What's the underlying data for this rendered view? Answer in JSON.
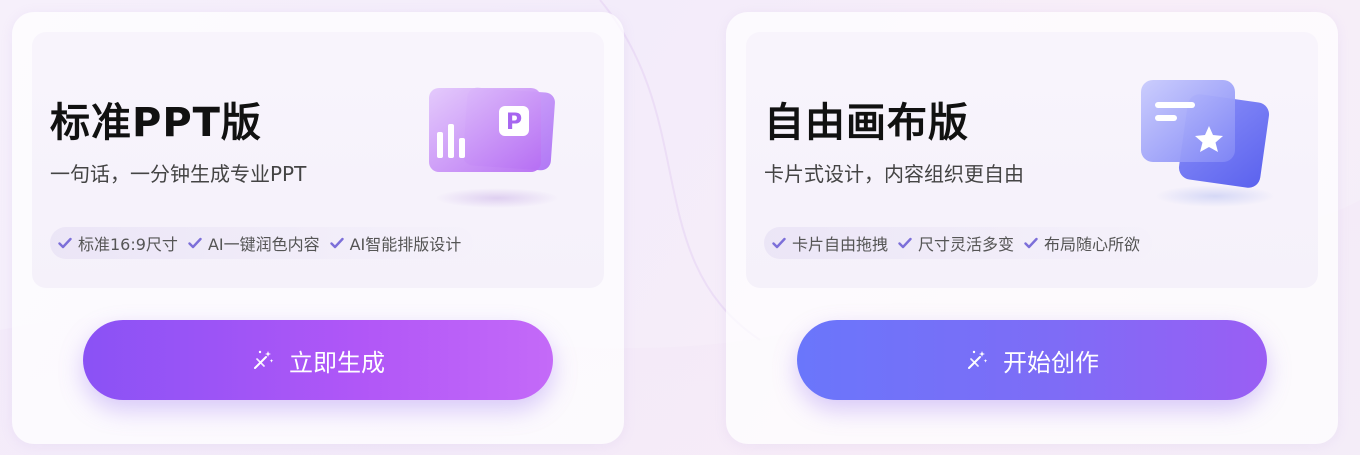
{
  "cards": [
    {
      "title": "标准PPT版",
      "subtitle": "一句话，一分钟生成专业PPT",
      "features": [
        "标准16:9尺寸",
        "AI一键润色内容",
        "AI智能排版设计"
      ],
      "button_label": "立即生成",
      "illustration_icon": "ppt-chart-icon"
    },
    {
      "title": "自由画布版",
      "subtitle": "卡片式设计，内容组织更自由",
      "features": [
        "卡片自由拖拽",
        "尺寸灵活多变",
        "布局随心所欲"
      ],
      "button_label": "开始创作",
      "illustration_icon": "canvas-star-card-icon"
    }
  ],
  "colors": {
    "accent_purple": "#a355f7",
    "accent_blue": "#6a76fb",
    "check": "#7c6fd9"
  }
}
